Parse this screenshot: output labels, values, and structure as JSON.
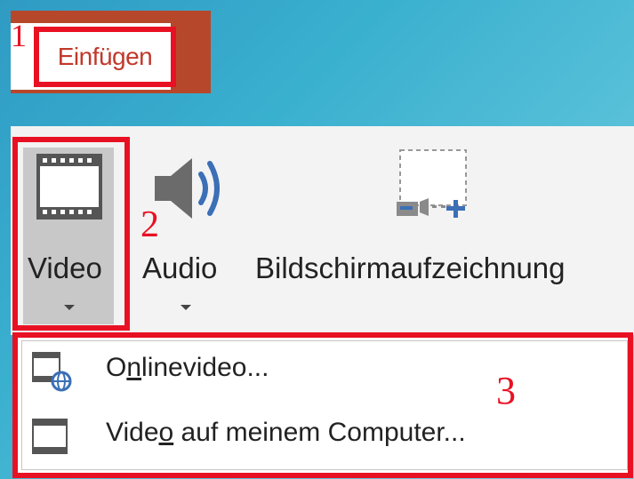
{
  "steps": {
    "one": "1",
    "two": "2",
    "three": "3"
  },
  "tab": {
    "label": "Einfügen"
  },
  "ribbon": {
    "video_label": "Video",
    "audio_label": "Audio",
    "screen_rec_label": "Bildschirmaufzeichnung"
  },
  "menu": {
    "online_video": {
      "pre": "O",
      "accel": "n",
      "post": "linevideo..."
    },
    "computer_video": {
      "pre": "Vide",
      "accel": "o",
      "post": " auf meinem Computer..."
    }
  },
  "icons": {
    "tab_step": "none",
    "video": "film-strip-icon",
    "audio": "speaker-icon",
    "screen_recording": "screen-recording-icon",
    "online_video": "online-video-icon",
    "computer_video": "film-strip-icon"
  },
  "colors": {
    "highlight": "#e81123",
    "tab_accent": "#b7472a",
    "background": "#3ab0cf"
  }
}
